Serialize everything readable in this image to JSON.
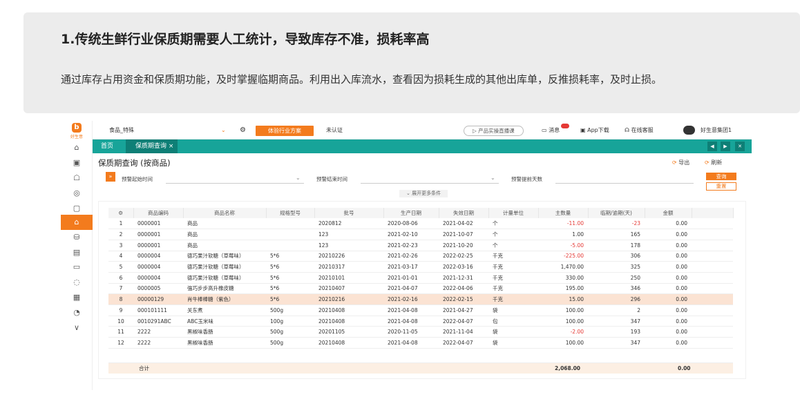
{
  "intro": {
    "title": "1.传统生鲜行业保质期需要人工统计，导致库存不准，损耗率高",
    "description": "通过库存占用资金和保质期功能，及时掌握临期商品。利用出入库流水，查看因为损耗生成的其他出库单，反推损耗率，及时止损。"
  },
  "app": {
    "logo_text": "好生意",
    "topbar": {
      "store": "食品_特殊",
      "industry_button": "体验行业方案",
      "auth_status": "未认证",
      "live_pill": "产品实操直播课",
      "messages": "消息",
      "app_download": "App下载",
      "online_service": "在线客服",
      "user": "好生意集团1"
    },
    "tabs": {
      "home": "首页",
      "current": "保质期查询"
    },
    "page_title": "保质期查询 (按商品)",
    "tools": {
      "export": "导出",
      "refresh": "刷新"
    },
    "filters": {
      "start_label": "预警起始时间",
      "end_label": "预警结束时间",
      "days_label": "预警提前天数",
      "more_label": "展开更多条件",
      "query_button": "查询",
      "reset_button": "重置"
    },
    "table": {
      "columns": [
        "商品编码",
        "商品名称",
        "规格型号",
        "批号",
        "生产日期",
        "失效日期",
        "计量单位",
        "主数量",
        "临期/逾期(天)",
        "金额"
      ],
      "rows": [
        {
          "idx": "1",
          "code": "0000001",
          "name": "商品",
          "spec": "",
          "batch": "2020812",
          "prod": "2020-08-06",
          "exp": "2021-04-02",
          "unit": "个",
          "qty": "-11.00",
          "days": "-23",
          "amount": "0.00"
        },
        {
          "idx": "2",
          "code": "0000001",
          "name": "商品",
          "spec": "",
          "batch": "123",
          "prod": "2021-02-10",
          "exp": "2021-10-07",
          "unit": "个",
          "qty": "1.00",
          "days": "165",
          "amount": "0.00"
        },
        {
          "idx": "3",
          "code": "0000001",
          "name": "商品",
          "spec": "",
          "batch": "123",
          "prod": "2021-02-23",
          "exp": "2021-10-20",
          "unit": "个",
          "qty": "-5.00",
          "days": "178",
          "amount": "0.00"
        },
        {
          "idx": "4",
          "code": "0000004",
          "name": "德巧果汁软糖（草莓味）",
          "spec": "5*6",
          "batch": "20210226",
          "prod": "2021-02-26",
          "exp": "2022-02-25",
          "unit": "千克",
          "qty": "-225.00",
          "days": "306",
          "amount": "0.00"
        },
        {
          "idx": "5",
          "code": "0000004",
          "name": "德巧果汁软糖（草莓味）",
          "spec": "5*6",
          "batch": "20210317",
          "prod": "2021-03-17",
          "exp": "2022-03-16",
          "unit": "千克",
          "qty": "1,470.00",
          "days": "325",
          "amount": "0.00"
        },
        {
          "idx": "6",
          "code": "0000004",
          "name": "德巧果汁软糖（草莓味）",
          "spec": "5*6",
          "batch": "20210101",
          "prod": "2021-01-01",
          "exp": "2021-12-31",
          "unit": "千克",
          "qty": "330.00",
          "days": "250",
          "amount": "0.00"
        },
        {
          "idx": "7",
          "code": "0000005",
          "name": "強巧步步高升橡皮糖",
          "spec": "5*6",
          "batch": "20210407",
          "prod": "2021-04-07",
          "exp": "2022-04-06",
          "unit": "千克",
          "qty": "195.00",
          "days": "346",
          "amount": "0.00"
        },
        {
          "idx": "8",
          "code": "00000129",
          "name": "肖牛棒棒糖（紫色）",
          "spec": "5*6",
          "batch": "20210216",
          "prod": "2021-02-16",
          "exp": "2022-02-15",
          "unit": "千克",
          "qty": "15.00",
          "days": "296",
          "amount": "0.00"
        },
        {
          "idx": "9",
          "code": "000101111",
          "name": "关东煮",
          "spec": "500g",
          "batch": "20210408",
          "prod": "2021-04-08",
          "exp": "2021-04-27",
          "unit": "袋",
          "qty": "100.00",
          "days": "2",
          "amount": "0.00"
        },
        {
          "idx": "10",
          "code": "0010291ABC",
          "name": "ABC玉米味",
          "spec": "100g",
          "batch": "20210408",
          "prod": "2021-04-08",
          "exp": "2022-04-07",
          "unit": "包",
          "qty": "100.00",
          "days": "347",
          "amount": "0.00"
        },
        {
          "idx": "11",
          "code": "2222",
          "name": "黑椒味香肠",
          "spec": "500g",
          "batch": "20201105",
          "prod": "2020-11-05",
          "exp": "2021-11-04",
          "unit": "袋",
          "qty": "-2.00",
          "days": "193",
          "amount": "0.00"
        },
        {
          "idx": "12",
          "code": "2222",
          "name": "黑椒味香肠",
          "spec": "500g",
          "batch": "20210408",
          "prod": "2021-04-08",
          "exp": "2022-04-07",
          "unit": "袋",
          "qty": "100.00",
          "days": "347",
          "amount": "0.00"
        }
      ],
      "total_label": "合计",
      "total_qty": "2,068.00",
      "total_amount": "0.00"
    }
  }
}
